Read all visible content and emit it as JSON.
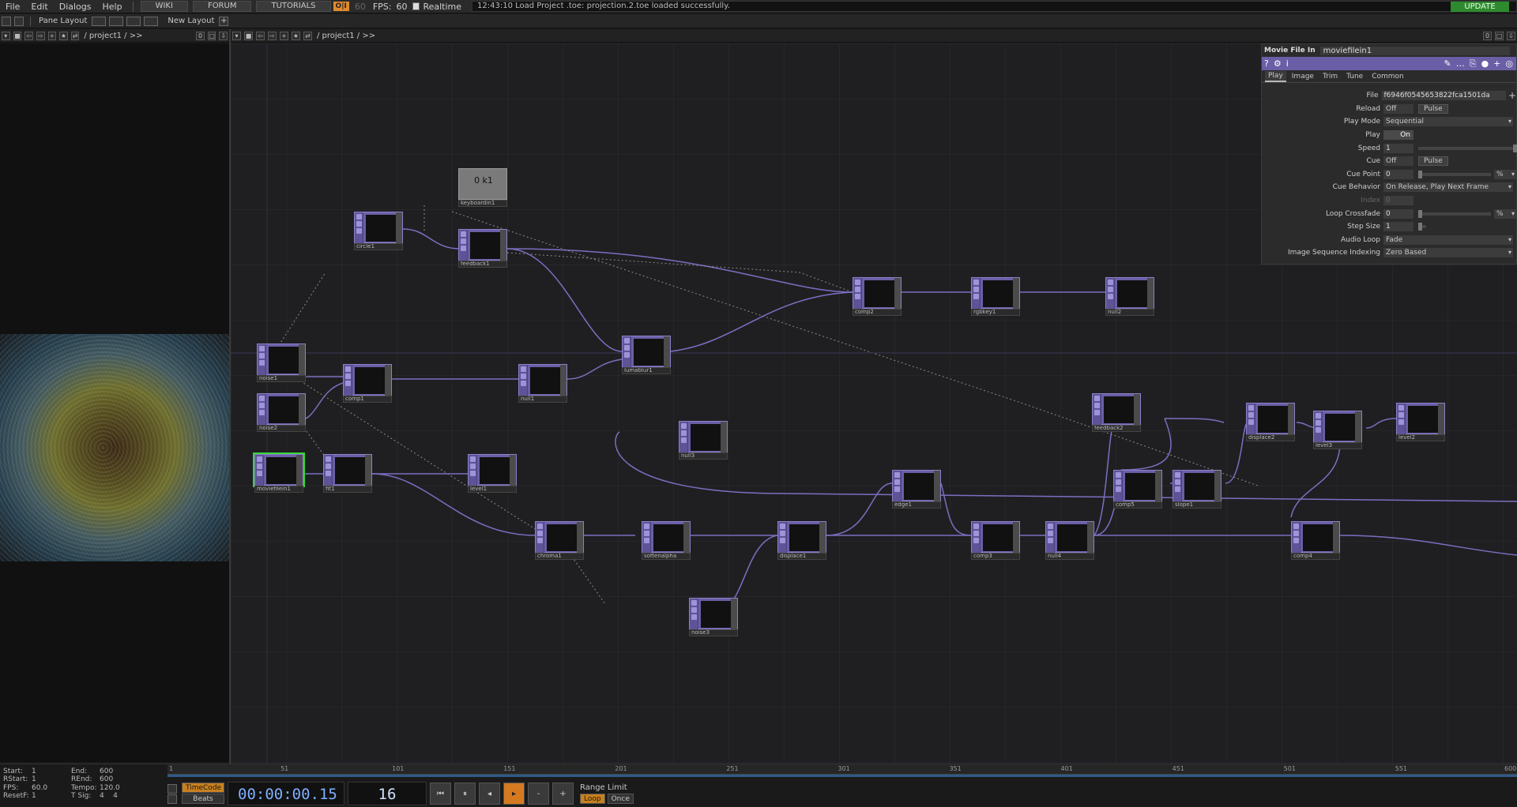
{
  "menu": {
    "items": [
      "File",
      "Edit",
      "Dialogs",
      "Help"
    ],
    "wiki": "WIKI",
    "forum": "FORUM",
    "tutorials": "TUTORIALS",
    "td_badge": "O|I",
    "fps_dim": "60",
    "fps_label": "FPS:",
    "fps_value": "60",
    "realtime": "Realtime",
    "status": "12:43:10 Load Project .toe: projection.2.toe loaded successfully.",
    "update": "UPDATE"
  },
  "toolbar": {
    "pane_layout": "Pane Layout",
    "new_layout": "New Layout"
  },
  "left_path": {
    "path": "/ project1 / >>",
    "count": "0"
  },
  "net_path": {
    "path": "/ project1 / >>",
    "count": "0"
  },
  "nodes": [
    {
      "name": "circle1"
    },
    {
      "name": "keyboardin1",
      "value": "0 k1"
    },
    {
      "name": "feedback1"
    },
    {
      "name": "noise1"
    },
    {
      "name": "comp1"
    },
    {
      "name": "null1"
    },
    {
      "name": "lumablur1"
    },
    {
      "name": "noise2"
    },
    {
      "name": "moviefilein1"
    },
    {
      "name": "fit1"
    },
    {
      "name": "level1"
    },
    {
      "name": "comp2"
    },
    {
      "name": "rgbkey1"
    },
    {
      "name": "null2"
    },
    {
      "name": "null3"
    },
    {
      "name": "chroma1"
    },
    {
      "name": "softenalpha"
    },
    {
      "name": "noise3"
    },
    {
      "name": "displace1"
    },
    {
      "name": "edge1"
    },
    {
      "name": "comp3"
    },
    {
      "name": "null4"
    },
    {
      "name": "feedback2"
    },
    {
      "name": "comp5"
    },
    {
      "name": "slope1"
    },
    {
      "name": "displace2"
    },
    {
      "name": "level3"
    },
    {
      "name": "level2"
    },
    {
      "name": "comp4"
    }
  ],
  "params": {
    "op_type": "Movie File In",
    "op_name": "moviefilein1",
    "tabs": [
      "Play",
      "Image",
      "Trim",
      "Tune",
      "Common"
    ],
    "file_label": "File",
    "file_value": "f6946f0545653822fca1501da",
    "reload_label": "Reload",
    "reload_value": "Off",
    "reload_pulse": "Pulse",
    "playmode_label": "Play Mode",
    "playmode_value": "Sequential",
    "play_label": "Play",
    "play_value": "On",
    "speed_label": "Speed",
    "speed_value": "1",
    "cue_label": "Cue",
    "cue_value": "Off",
    "cue_pulse": "Pulse",
    "cuepoint_label": "Cue Point",
    "cuepoint_value": "0",
    "cuepoint_unit": "%",
    "cuebehavior_label": "Cue Behavior",
    "cuebehavior_value": "On Release, Play Next Frame",
    "index_label": "Index",
    "index_value": "0",
    "loopcf_label": "Loop Crossfade",
    "loopcf_value": "0",
    "loopcf_unit": "%",
    "step_label": "Step Size",
    "step_value": "1",
    "audioloop_label": "Audio Loop",
    "audioloop_value": "Fade",
    "seqidx_label": "Image Sequence Indexing",
    "seqidx_value": "Zero Based"
  },
  "stats": {
    "start_l": "Start:",
    "start_v": "1",
    "end_l": "End:",
    "end_v": "600",
    "rstart_l": "RStart:",
    "rstart_v": "1",
    "rend_l": "REnd:",
    "rend_v": "600",
    "fps_l": "FPS:",
    "fps_v": "60.0",
    "tempo_l": "Tempo:",
    "tempo_v": "120.0",
    "resetf_l": "ResetF:",
    "resetf_v": "1",
    "tsig_l": "T Sig:",
    "tsig_v": "4    4"
  },
  "ruler": {
    "ticks": [
      "1",
      "51",
      "101",
      "151",
      "201",
      "251",
      "301",
      "351",
      "401",
      "451",
      "501",
      "551",
      "600"
    ]
  },
  "transport": {
    "timecode_btn": "TimeCode",
    "beats_btn": "Beats",
    "timecode": "00:00:00.15",
    "frame": "16",
    "range_limit": "Range Limit",
    "loop": "Loop",
    "once": "Once"
  }
}
